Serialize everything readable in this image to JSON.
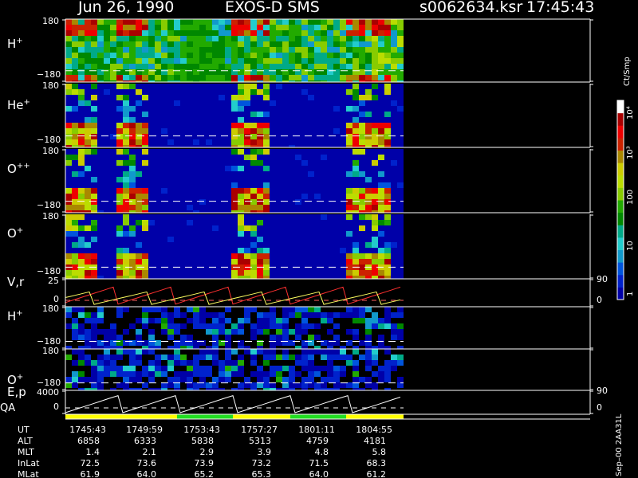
{
  "header": {
    "date": "Jun 26, 1990",
    "instrument": "EXOS-D SMS",
    "file": "s0062634.ksr",
    "time": "17:45:43"
  },
  "panels": [
    {
      "label": "H",
      "sup": "+",
      "ytop": "180",
      "ybot": "−180"
    },
    {
      "label": "He",
      "sup": "+",
      "ytop": "180",
      "ybot": "−180"
    },
    {
      "label": "O",
      "sup": "++",
      "ytop": "180",
      "ybot": "−180"
    },
    {
      "label": "O",
      "sup": "+",
      "ytop": "180",
      "ybot": "−180"
    },
    {
      "label": "V,r",
      "sup": "",
      "ytop": "25",
      "ybot": "0",
      "rtop": "90",
      "rbot": "0"
    },
    {
      "label": "H",
      "sup": "+",
      "ytop": "180",
      "ybot": "−180"
    },
    {
      "label": "O",
      "sup": "+",
      "ytop": "180",
      "ybot": "−180"
    },
    {
      "label": "E,p",
      "sup": "",
      "ytop": "4000",
      "ybot": "0",
      "rtop": "90",
      "rbot": "0"
    }
  ],
  "qa_label": "QA",
  "colorbar": {
    "unit": "Ct/Smp",
    "ticks": [
      "10⁴",
      "10³",
      "100",
      "10",
      "1"
    ]
  },
  "footer_code": "Sep–00 2AA31L",
  "orbit_table": {
    "rows": [
      {
        "name": "UT",
        "values": [
          "1745:43",
          "1749:59",
          "1753:43",
          "1757:27",
          "1801:11",
          "1804:55"
        ]
      },
      {
        "name": "ALT",
        "values": [
          "6858",
          "6333",
          "5838",
          "5313",
          "4759",
          "4181"
        ]
      },
      {
        "name": "MLT",
        "values": [
          "1.4",
          "2.1",
          "2.9",
          "3.9",
          "4.8",
          "5.8"
        ]
      },
      {
        "name": "InLat",
        "values": [
          "72.5",
          "73.6",
          "73.9",
          "73.2",
          "71.5",
          "68.3"
        ]
      },
      {
        "name": "MLat",
        "values": [
          "61.9",
          "64.0",
          "65.2",
          "65.3",
          "64.0",
          "61.2"
        ]
      }
    ]
  },
  "chart_data": {
    "type": "heatmap",
    "title": "Jun 26, 1990   EXOS-D SMS",
    "x_tick_labels": [
      "1745:43",
      "1749:59",
      "1753:43",
      "1757:27",
      "1801:11",
      "1804:55"
    ],
    "data_end_time": "1804:55",
    "color_scale": {
      "unit": "Ct/Smp",
      "log": true,
      "range": [
        1,
        10000
      ]
    },
    "spectrograms": [
      {
        "species": "H+",
        "y_range": [
          -180,
          180
        ],
        "ylabel": "H+"
      },
      {
        "species": "He+",
        "y_range": [
          -180,
          180
        ],
        "ylabel": "He+"
      },
      {
        "species": "O++",
        "y_range": [
          -180,
          180
        ],
        "ylabel": "O++"
      },
      {
        "species": "O+",
        "y_range": [
          -180,
          180
        ],
        "ylabel": "O+"
      },
      {
        "species": "H+",
        "y_range": [
          -180,
          180
        ],
        "ylabel": "H+"
      },
      {
        "species": "O+",
        "y_range": [
          -180,
          180
        ],
        "ylabel": "O+"
      }
    ],
    "line_panels": [
      {
        "ylabel": "V,r",
        "y_range": [
          0,
          25
        ],
        "right_range": [
          0,
          90
        ]
      },
      {
        "ylabel": "E,p",
        "y_range": [
          0,
          4000
        ],
        "right_range": [
          0,
          90
        ]
      }
    ],
    "quality_bar": {
      "label": "QA",
      "colors": [
        "#ffff00",
        "#22dd22",
        "#ffff00"
      ]
    },
    "palette": [
      "#0000a8",
      "#0022cc",
      "#0055dd",
      "#1199cc",
      "#22cccc",
      "#00aa88",
      "#008800",
      "#22aa00",
      "#88cc00",
      "#bbdd00",
      "#cccc00",
      "#aa8800",
      "#cc2200",
      "#ee0000",
      "#aa0000",
      "#ffffff"
    ]
  }
}
